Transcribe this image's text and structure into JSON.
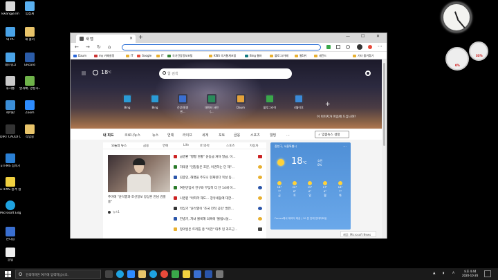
{
  "desktop": {
    "icons": [
      {
        "label": "kwangje.lm",
        "color": "#d9d9d9",
        "icon": "user-folder-icon"
      },
      {
        "label": "입접계",
        "color": "#5ab0f0",
        "icon": "app-icon"
      },
      {
        "label": "내 PC",
        "color": "#4aa3e8",
        "icon": "pc-icon"
      },
      {
        "label": "새 폴더",
        "color": "#e8c46a",
        "icon": "folder-icon"
      },
      {
        "label": "네트워크",
        "color": "#4aa3e8",
        "icon": "network-icon"
      },
      {
        "label": "ERcord",
        "color": "#2b5ca8",
        "icon": "app-icon"
      },
      {
        "label": "휴지통",
        "color": "#c9c9c9",
        "icon": "recycle-bin-icon"
      },
      {
        "label": "날개배, 양승하그럼사...",
        "color": "#6fb34a",
        "icon": "app-icon"
      },
      {
        "label": "제어판",
        "color": "#3b8ed8",
        "icon": "control-panel-icon"
      },
      {
        "label": "Zoom",
        "color": "#2d8cff",
        "icon": "zoom-icon"
      },
      {
        "label": "DIRT CAUDI CRU-2...",
        "color": "#333333",
        "icon": "app-icon"
      },
      {
        "label": "작업중",
        "color": "#e8c46a",
        "icon": "folder-icon"
      },
      {
        "label": "uTFMS 접속기",
        "color": "#2a7fd4",
        "icon": "app-icon"
      },
      {
        "label": "uTFMS 원격 접속기 도우미",
        "color": "#f0d040",
        "icon": "app-icon"
      },
      {
        "label": "Microsoft Edge",
        "color": "#1ea2e0",
        "icon": "edge-icon"
      },
      {
        "label": "한디힘",
        "color": "#3a6fd0",
        "icon": "app-icon"
      },
      {
        "label": "알림",
        "color": "#eeeeee",
        "icon": "app-icon"
      }
    ],
    "gadget_gauge_left": "0%",
    "gadget_gauge_right": "33%"
  },
  "browser": {
    "tab_title": "새 탭",
    "new_tab": "+",
    "window_controls": [
      "—",
      "☐",
      "✕"
    ],
    "nav_buttons": [
      "←",
      "→",
      "↻",
      "⌂"
    ],
    "address_value": "",
    "bookmarks": [
      {
        "label": "Daum",
        "color": "#2a66d8"
      },
      {
        "label": "my 카페설정",
        "color": "#cc3333"
      },
      {
        "label": "IT",
        "color": "#e8b030"
      },
      {
        "label": "Google",
        "color": "#e84a3a"
      },
      {
        "label": "IT",
        "color": "#e8b030"
      },
      {
        "label": "국가건강정보포털",
        "color": "#3a8a3a"
      },
      {
        "label": "KISS 국가통계포털",
        "color": "#e8b030"
      },
      {
        "label": "Bing 웹마",
        "color": "#137a7f"
      },
      {
        "label": "블로그/카페",
        "color": "#e8b030"
      },
      {
        "label": "웹1위",
        "color": "#e8b030"
      },
      {
        "label": "세컨드",
        "color": "#e8b030"
      },
      {
        "label": "기타 즐겨찾기",
        "color": "#e8b030"
      }
    ]
  },
  "newtab": {
    "weather_temp": "18",
    "weather_unit": "°C",
    "search_placeholder": "웹 검색",
    "quick_links": [
      {
        "label": "Bing",
        "color": "#2a9bd6"
      },
      {
        "label": "Bing",
        "color": "#2a9bd6"
      },
      {
        "label": "건강(질병 관...",
        "color": "#3a6fd0"
      },
      {
        "label": "데이터 사전 (...",
        "color": "#2a8a5a"
      },
      {
        "label": "Daum",
        "color": "#e4a23a"
      },
      {
        "label": "블루그라이",
        "color": "#3aa84a"
      },
      {
        "label": "4월이후",
        "color": "#3a8ad8"
      }
    ],
    "add_link": "+",
    "image_caption": "이 이미지가 마음에 드십니까?",
    "news_nav": [
      "내 피드",
      "코로나뉴스",
      "뉴스",
      "연예",
      "라이프",
      "세계",
      "포토",
      "금융",
      "스포츠",
      "웰빙",
      "..."
    ],
    "personalize": "✓ 맞춤뉴스 설정",
    "sub_tabs": [
      "오늘의 뉴스",
      "금융",
      "연예",
      "Life",
      "IT/과학",
      "스포츠",
      "자동차"
    ],
    "lead_title": "추미애 \"윤석열과 조선일보 방상훈 만남 감찰 중\"",
    "lead_source": "뉴스1",
    "news_items": [
      {
        "text": "금경환 \"빵빵 현황\" 윤송금 처자 발급, 이...",
        "src": "#cc2222",
        "flag": "#cc2222"
      },
      {
        "text": "하태경 \"검찰들은 조문, 이견하는 단 해\"...",
        "src": "#2a7a2a",
        "flag": "#e8b030"
      },
      {
        "text": "김종인, 해명을 주도니 현재된다 목성 동...",
        "src": "#2a55aa",
        "flag": "#e8b030"
      },
      {
        "text": "여천만입서 친구와 부딪히 더 단 14세 이...",
        "src": "#2a7a2a",
        "flag": "#2a55aa"
      },
      {
        "text": "나경원 \"아파라 해도... 장유세들에 대한...",
        "src": "#cc2222",
        "flag": "#e8b030"
      },
      {
        "text": "박상기 \"윤석열이 '조국 전적 공민' 발언...",
        "src": "#333333",
        "flag": "#2a55aa"
      },
      {
        "text": "진병기, 자녀 불룩해 의혹에 '불법시설...",
        "src": "#2a55aa",
        "flag": "#e8b030"
      },
      {
        "text": "정의일은 트리튬 충 \"이전\" 대추 된 과조근...",
        "src": "#e8b030",
        "flag": "#444444"
      }
    ],
    "weather_card": {
      "location": "중천구, 서울특별시",
      "more": "...",
      "temp": "18",
      "unit": "°C",
      "rain_label": "흐린",
      "rain_pct": "0%",
      "days": [
        {
          "name": "금",
          "hi": "18°",
          "lo": "7°"
        },
        {
          "name": "토",
          "hi": "20°",
          "lo": "8°"
        },
        {
          "name": "일",
          "hi": "15°",
          "lo": "6°"
        },
        {
          "name": "월",
          "hi": "17°",
          "lo": "6°"
        },
        {
          "name": "화",
          "hi": "18°",
          "lo": "7°"
        }
      ],
      "footer": "Foreca에서 데이터 제공 | 10 분 전에 업데이트됨"
    },
    "msn_tag": "제공: Microsoft News"
  },
  "taskbar": {
    "search_placeholder": "검색하려면 여기에 입력하십시오.",
    "apps": [
      {
        "name": "edge-app",
        "color": "#1ea2e0"
      },
      {
        "name": "zoom-app",
        "color": "#2d8cff"
      },
      {
        "name": "explorer-app",
        "color": "#e8c46a"
      },
      {
        "name": "store-app",
        "color": "#2a7fd4"
      },
      {
        "name": "chrome-app",
        "color": "#e84a3a"
      },
      {
        "name": "mail-app",
        "color": "#3a6fd0"
      },
      {
        "name": "photos-app",
        "color": "#3aa84a"
      },
      {
        "name": "media-app",
        "color": "#f0d040"
      },
      {
        "name": "settings-app",
        "color": "#777777"
      },
      {
        "name": "app-extra",
        "color": "#2a55aa"
      },
      {
        "name": "app-extra-2",
        "color": "#e8b030"
      }
    ],
    "time": "오후 4:44",
    "date": "2020-10-26",
    "lang": "A"
  }
}
